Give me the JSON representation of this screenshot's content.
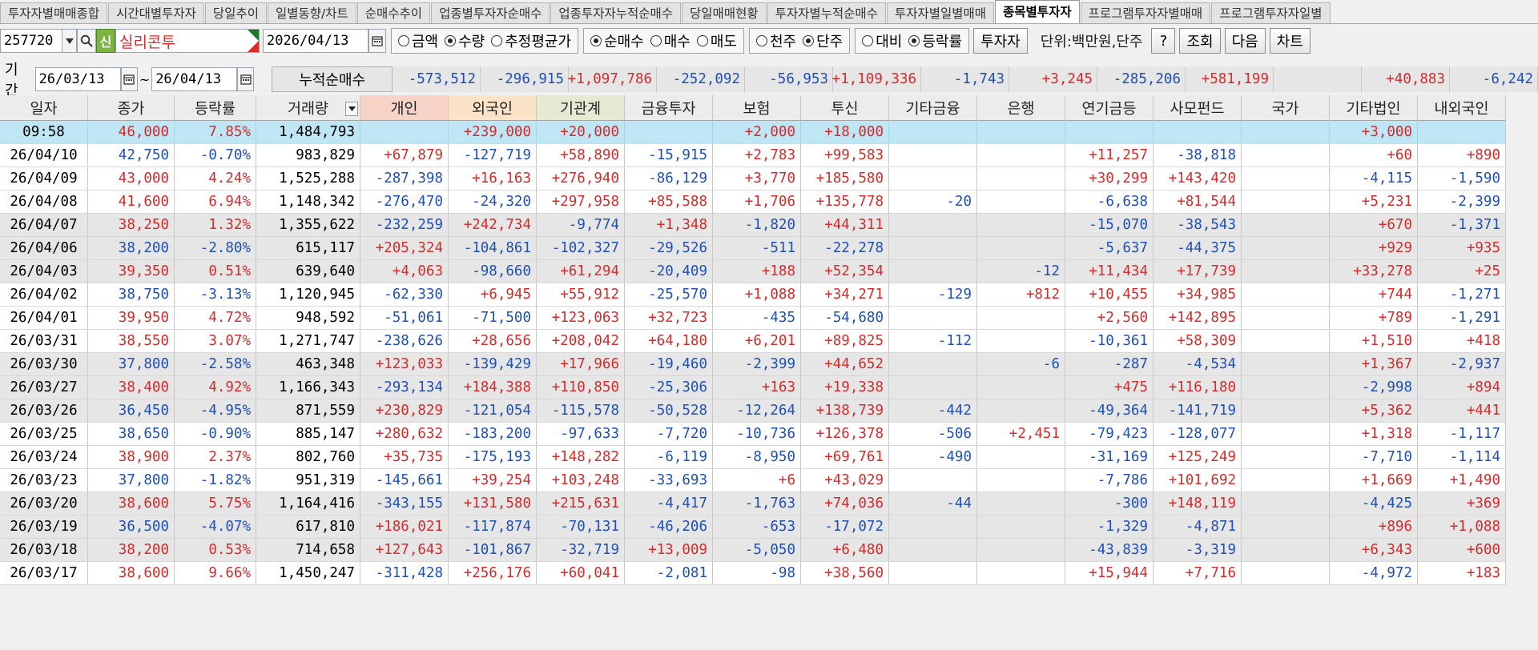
{
  "tabs": [
    {
      "label": "투자자별매매종합",
      "active": false
    },
    {
      "label": "시간대별투자자",
      "active": false
    },
    {
      "label": "당일추이",
      "active": false
    },
    {
      "label": "일별동향/차트",
      "active": false
    },
    {
      "label": "순매수추이",
      "active": false
    },
    {
      "label": "업종별투자자순매수",
      "active": false
    },
    {
      "label": "업종투자자누적순매수",
      "active": false
    },
    {
      "label": "당일매매현황",
      "active": false
    },
    {
      "label": "투자자별누적순매수",
      "active": false
    },
    {
      "label": "투자자별일별매매",
      "active": false
    },
    {
      "label": "종목별투자자",
      "active": true
    },
    {
      "label": "프로그램투자자별매매",
      "active": false
    },
    {
      "label": "프로그램투자자일별",
      "active": false
    }
  ],
  "toolbar": {
    "code": "257720",
    "new_badge": "신",
    "stock_name": "실리콘투",
    "date": "2026/04/13",
    "radio_group1": [
      {
        "label": "금액",
        "checked": false
      },
      {
        "label": "수량",
        "checked": true
      },
      {
        "label": "추정평균가",
        "checked": false
      }
    ],
    "radio_group2": [
      {
        "label": "순매수",
        "checked": true
      },
      {
        "label": "매수",
        "checked": false
      },
      {
        "label": "매도",
        "checked": false
      }
    ],
    "radio_group3": [
      {
        "label": "천주",
        "checked": false
      },
      {
        "label": "단주",
        "checked": true
      }
    ],
    "radio_group4": [
      {
        "label": "대비",
        "checked": false
      },
      {
        "label": "등락률",
        "checked": true
      }
    ],
    "investor_button": "투자자",
    "unit_label": "단위:백만원,단주",
    "help_button": "?",
    "query_button": "조회",
    "next_button": "다음",
    "chart_button": "차트"
  },
  "period": {
    "label": "기간",
    "from": "26/03/13",
    "separator": "~",
    "to": "26/04/13",
    "cumulative_label": "누적순매수",
    "cumulative_values": [
      "-573,512",
      "-296,915",
      "+1,097,786",
      "-252,092",
      "-56,953",
      "+1,109,336",
      "-1,743",
      "+3,245",
      "-285,206",
      "+581,199",
      "",
      "+40,883",
      "-6,242"
    ]
  },
  "table": {
    "columns": [
      "일자",
      "종가",
      "등락률",
      "거래량",
      "개인",
      "외국인",
      "기관계",
      "금융투자",
      "보험",
      "투신",
      "기타금융",
      "은행",
      "연기금등",
      "사모펀드",
      "국가",
      "기타법인",
      "내외국인"
    ],
    "rows": [
      [
        "09:58",
        "46,000",
        "7.85%",
        "1,484,793",
        "",
        "+239,000",
        "+20,000",
        "",
        "+2,000",
        "+18,000",
        "",
        "",
        "",
        "",
        "",
        "+3,000",
        ""
      ],
      [
        "26/04/10",
        "42,750",
        "-0.70%",
        "983,829",
        "+67,879",
        "-127,719",
        "+58,890",
        "-15,915",
        "+2,783",
        "+99,583",
        "",
        "",
        "+11,257",
        "-38,818",
        "",
        "+60",
        "+890"
      ],
      [
        "26/04/09",
        "43,000",
        "4.24%",
        "1,525,288",
        "-287,398",
        "+16,163",
        "+276,940",
        "-86,129",
        "+3,770",
        "+185,580",
        "",
        "",
        "+30,299",
        "+143,420",
        "",
        "-4,115",
        "-1,590"
      ],
      [
        "26/04/08",
        "41,600",
        "6.94%",
        "1,148,342",
        "-276,470",
        "-24,320",
        "+297,958",
        "+85,588",
        "+1,706",
        "+135,778",
        "-20",
        "",
        "-6,638",
        "+81,544",
        "",
        "+5,231",
        "-2,399"
      ],
      [
        "26/04/07",
        "38,250",
        "1.32%",
        "1,355,622",
        "-232,259",
        "+242,734",
        "-9,774",
        "+1,348",
        "-1,820",
        "+44,311",
        "",
        "",
        "-15,070",
        "-38,543",
        "",
        "+670",
        "-1,371"
      ],
      [
        "26/04/06",
        "38,200",
        "-2.80%",
        "615,117",
        "+205,324",
        "-104,861",
        "-102,327",
        "-29,526",
        "-511",
        "-22,278",
        "",
        "",
        "-5,637",
        "-44,375",
        "",
        "+929",
        "+935"
      ],
      [
        "26/04/03",
        "39,350",
        "0.51%",
        "639,640",
        "+4,063",
        "-98,660",
        "+61,294",
        "-20,409",
        "+188",
        "+52,354",
        "",
        "-12",
        "+11,434",
        "+17,739",
        "",
        "+33,278",
        "+25"
      ],
      [
        "26/04/02",
        "38,750",
        "-3.13%",
        "1,120,945",
        "-62,330",
        "+6,945",
        "+55,912",
        "-25,570",
        "+1,088",
        "+34,271",
        "-129",
        "+812",
        "+10,455",
        "+34,985",
        "",
        "+744",
        "-1,271"
      ],
      [
        "26/04/01",
        "39,950",
        "4.72%",
        "948,592",
        "-51,061",
        "-71,500",
        "+123,063",
        "+32,723",
        "-435",
        "-54,680",
        "",
        "",
        "+2,560",
        "+142,895",
        "",
        "+789",
        "-1,291"
      ],
      [
        "26/03/31",
        "38,550",
        "3.07%",
        "1,271,747",
        "-238,626",
        "+28,656",
        "+208,042",
        "+64,180",
        "+6,201",
        "+89,825",
        "-112",
        "",
        "-10,361",
        "+58,309",
        "",
        "+1,510",
        "+418"
      ],
      [
        "26/03/30",
        "37,800",
        "-2.58%",
        "463,348",
        "+123,033",
        "-139,429",
        "+17,966",
        "-19,460",
        "-2,399",
        "+44,652",
        "",
        "-6",
        "-287",
        "-4,534",
        "",
        "+1,367",
        "-2,937"
      ],
      [
        "26/03/27",
        "38,400",
        "4.92%",
        "1,166,343",
        "-293,134",
        "+184,388",
        "+110,850",
        "-25,306",
        "+163",
        "+19,338",
        "",
        "",
        "+475",
        "+116,180",
        "",
        "-2,998",
        "+894"
      ],
      [
        "26/03/26",
        "36,450",
        "-4.95%",
        "871,559",
        "+230,829",
        "-121,054",
        "-115,578",
        "-50,528",
        "-12,264",
        "+138,739",
        "-442",
        "",
        "-49,364",
        "-141,719",
        "",
        "+5,362",
        "+441"
      ],
      [
        "26/03/25",
        "38,650",
        "-0.90%",
        "885,147",
        "+280,632",
        "-183,200",
        "-97,633",
        "-7,720",
        "-10,736",
        "+126,378",
        "-506",
        "+2,451",
        "-79,423",
        "-128,077",
        "",
        "+1,318",
        "-1,117"
      ],
      [
        "26/03/24",
        "38,900",
        "2.37%",
        "802,760",
        "+35,735",
        "-175,193",
        "+148,282",
        "-6,119",
        "-8,950",
        "+69,761",
        "-490",
        "",
        "-31,169",
        "+125,249",
        "",
        "-7,710",
        "-1,114"
      ],
      [
        "26/03/23",
        "37,800",
        "-1.82%",
        "951,319",
        "-145,661",
        "+39,254",
        "+103,248",
        "-33,693",
        "+6",
        "+43,029",
        "",
        "",
        "-7,786",
        "+101,692",
        "",
        "+1,669",
        "+1,490"
      ],
      [
        "26/03/20",
        "38,600",
        "5.75%",
        "1,164,416",
        "-343,155",
        "+131,580",
        "+215,631",
        "-4,417",
        "-1,763",
        "+74,036",
        "-44",
        "",
        "-300",
        "+148,119",
        "",
        "-4,425",
        "+369"
      ],
      [
        "26/03/19",
        "36,500",
        "-4.07%",
        "617,810",
        "+186,021",
        "-117,874",
        "-70,131",
        "-46,206",
        "-653",
        "-17,072",
        "",
        "",
        "-1,329",
        "-4,871",
        "",
        "+896",
        "+1,088"
      ],
      [
        "26/03/18",
        "38,200",
        "0.53%",
        "714,658",
        "+127,643",
        "-101,867",
        "-32,719",
        "+13,009",
        "-5,050",
        "+6,480",
        "",
        "",
        "-43,839",
        "-3,319",
        "",
        "+6,343",
        "+600"
      ],
      [
        "26/03/17",
        "38,600",
        "9.66%",
        "1,450,247",
        "-311,428",
        "+256,176",
        "+60,041",
        "-2,081",
        "-98",
        "+38,560",
        "",
        "",
        "+15,944",
        "+7,716",
        "",
        "-4,972",
        "+183"
      ]
    ]
  },
  "colors": {
    "up": "#d62b2b",
    "down": "#1f50b8",
    "today_row": "#bfe6f4",
    "stripe": "#e6e6e6",
    "hdr_individual": "#f7d3c7",
    "hdr_foreign": "#fbe3c7",
    "hdr_institution": "#e6ead3"
  },
  "icons": [
    "search-icon",
    "calendar-icon",
    "chevron-down-icon",
    "sort-down-icon"
  ]
}
